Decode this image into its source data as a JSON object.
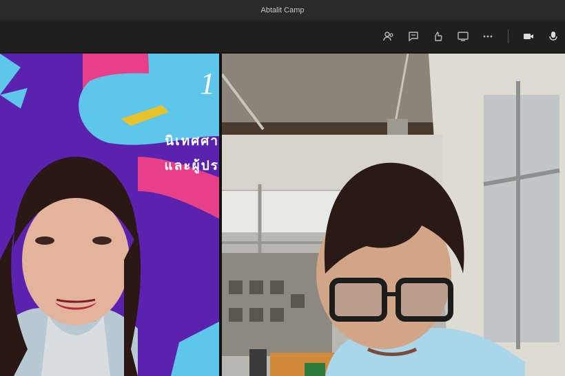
{
  "window": {
    "title": "Abtalit Camp"
  },
  "toolbar": {
    "buttons": [
      {
        "name": "participants-icon"
      },
      {
        "name": "chat-icon"
      },
      {
        "name": "reactions-icon"
      },
      {
        "name": "share-screen-icon"
      },
      {
        "name": "more-options-icon"
      },
      {
        "name": "camera-icon"
      }
    ]
  },
  "participants": [
    {
      "position": "left",
      "background_text_big": "1",
      "background_text_line1": "นิเทศศา",
      "background_text_line2": "และผู้ปร"
    },
    {
      "position": "right"
    }
  ],
  "colors": {
    "titlebar_bg": "#2a2a2a",
    "app_bg": "#1f1f1f",
    "left_bg": "#5b22b0",
    "accent_pink": "#e83f8a",
    "accent_cyan": "#5dc6ea"
  }
}
